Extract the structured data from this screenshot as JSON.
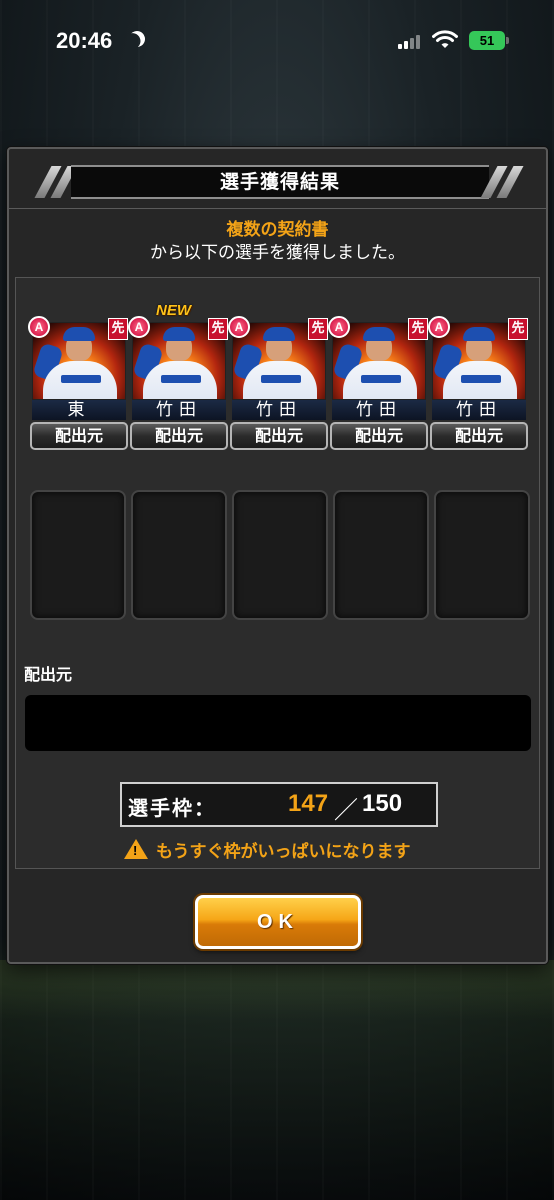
{
  "status_bar": {
    "time": "20:46",
    "battery": "51"
  },
  "dialog": {
    "title": "選手獲得結果",
    "message_highlight": "複数の契約書",
    "message_rest": "から以下の選手を獲得しました。",
    "cards": [
      {
        "rank": "A",
        "role": "先",
        "name": "東",
        "source_button": "配出元",
        "new_label": ""
      },
      {
        "rank": "A",
        "role": "先",
        "name": "竹田",
        "source_button": "配出元",
        "new_label": "NEW"
      },
      {
        "rank": "A",
        "role": "先",
        "name": "竹田",
        "source_button": "配出元",
        "new_label": ""
      },
      {
        "rank": "A",
        "role": "先",
        "name": "竹田",
        "source_button": "配出元",
        "new_label": ""
      },
      {
        "rank": "A",
        "role": "先",
        "name": "竹田",
        "source_button": "配出元",
        "new_label": ""
      }
    ],
    "source_label": "配出元",
    "slots": {
      "label": "選手枠：",
      "current": "147",
      "separator": "／",
      "max": "150"
    },
    "warning": "もうすぐ枠がいっぱいになります",
    "ok_label": "OK"
  },
  "colors": {
    "accent": "#f3a317",
    "panel": "#262626",
    "badge_red": "#c8102e"
  }
}
